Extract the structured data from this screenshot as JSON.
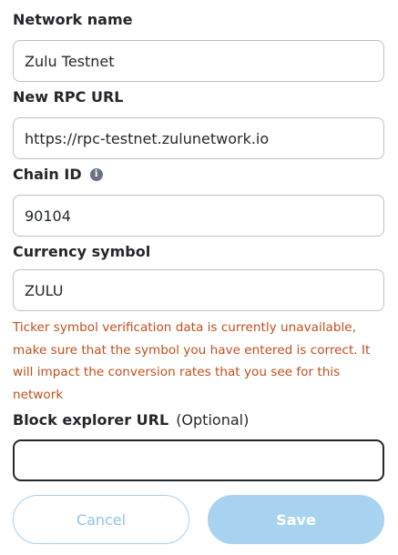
{
  "form": {
    "network_name": {
      "label": "Network name",
      "value": "Zulu Testnet"
    },
    "rpc_url": {
      "label": "New RPC URL",
      "value": "https://rpc-testnet.zulunetwork.io"
    },
    "chain_id": {
      "label": "Chain ID",
      "info_icon": "info-icon",
      "info_glyph": "i",
      "value": "90104"
    },
    "currency_symbol": {
      "label": "Currency symbol",
      "value": "ZULU",
      "warning": "Ticker symbol verification data is currently unavailable, make sure that the symbol you have entered is correct. It will impact the conversion rates that you see for this network"
    },
    "block_explorer": {
      "label": "Block explorer URL",
      "optional": "(Optional)",
      "value": ""
    }
  },
  "buttons": {
    "cancel_label": "Cancel",
    "save_label": "Save"
  },
  "colors": {
    "text": "#24272a",
    "border": "#bbc0c5",
    "warning": "#c24e1c",
    "primary_disabled": "#a8d3f0"
  }
}
